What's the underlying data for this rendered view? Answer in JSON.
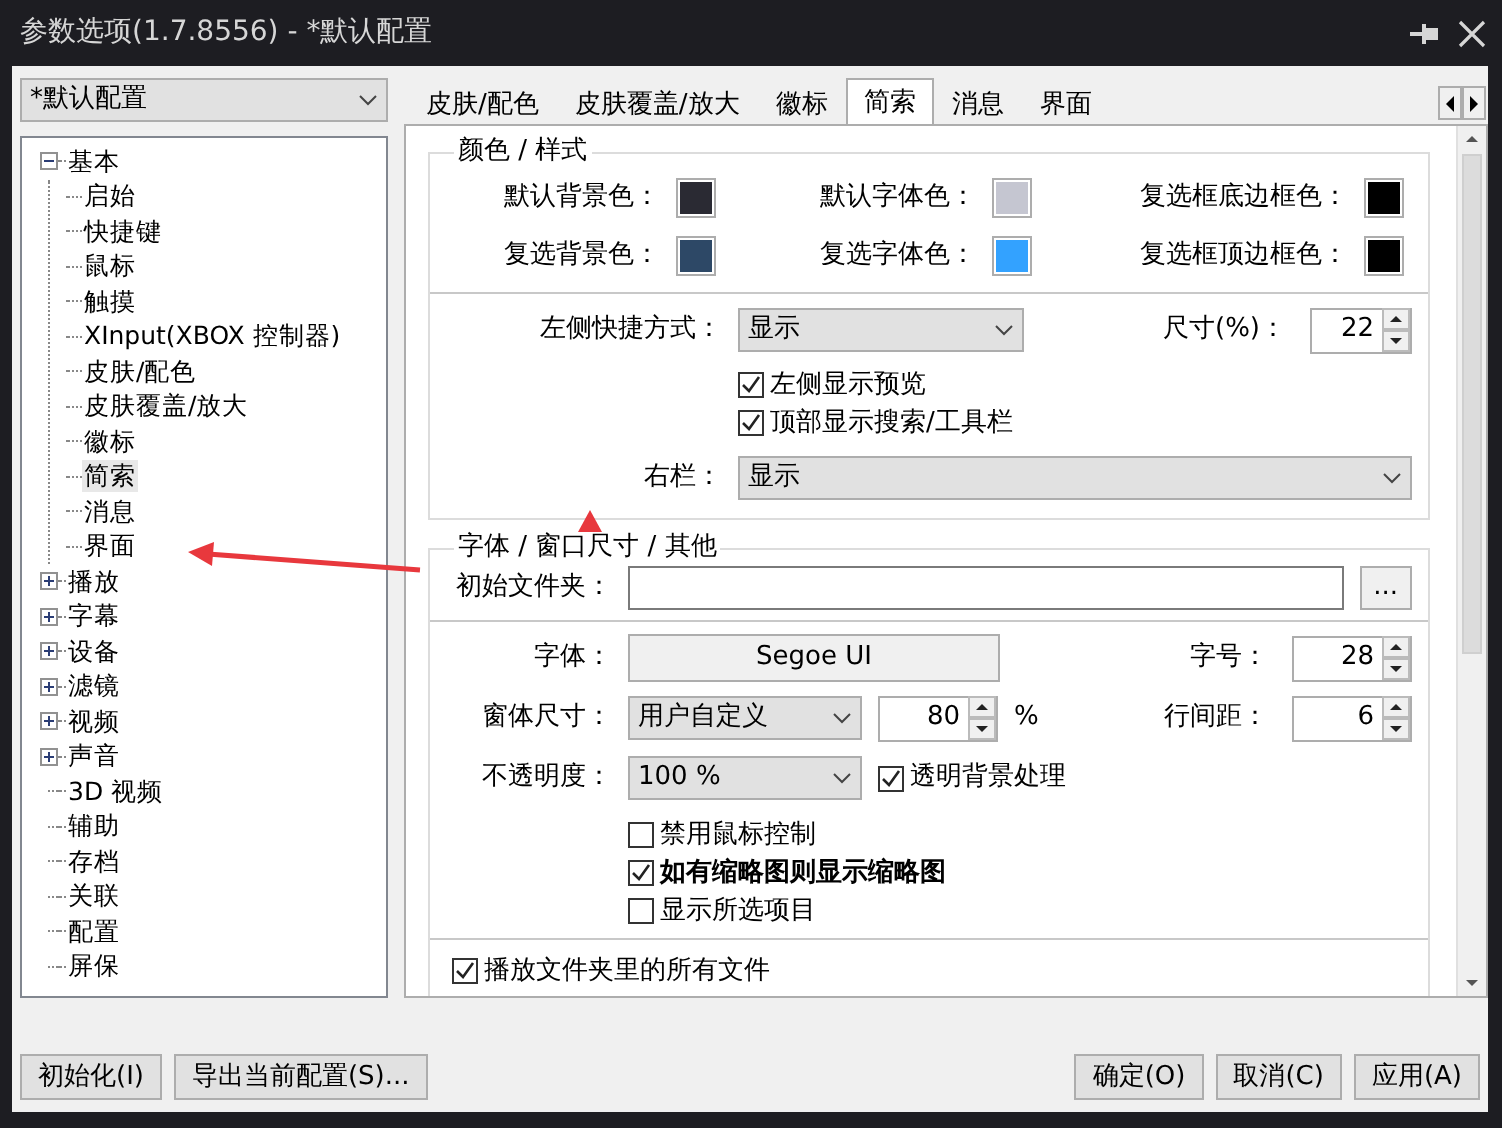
{
  "window": {
    "title": "参数选项(1.7.8556) - *默认配置"
  },
  "profile_select": {
    "value": "*默认配置"
  },
  "tree": [
    {
      "label": "基本",
      "kind": "group",
      "expanded": true,
      "selected": false,
      "children": [
        {
          "label": "启始",
          "selected": false
        },
        {
          "label": "快捷键",
          "selected": false
        },
        {
          "label": "鼠标",
          "selected": false
        },
        {
          "label": "触摸",
          "selected": false
        },
        {
          "label": "XInput(XBOX 控制器)",
          "selected": false
        },
        {
          "label": "皮肤/配色",
          "selected": false
        },
        {
          "label": "皮肤覆盖/放大",
          "selected": false
        },
        {
          "label": "徽标",
          "selected": false
        },
        {
          "label": "简索",
          "selected": true
        },
        {
          "label": "消息",
          "selected": false
        },
        {
          "label": "界面",
          "selected": false
        }
      ]
    },
    {
      "label": "播放",
      "kind": "group",
      "expanded": false,
      "selected": false
    },
    {
      "label": "字幕",
      "kind": "group",
      "expanded": false,
      "selected": false
    },
    {
      "label": "设备",
      "kind": "group",
      "expanded": false,
      "selected": false
    },
    {
      "label": "滤镜",
      "kind": "group",
      "expanded": false,
      "selected": false
    },
    {
      "label": "视频",
      "kind": "group",
      "expanded": false,
      "selected": false
    },
    {
      "label": "声音",
      "kind": "group",
      "expanded": false,
      "selected": false
    },
    {
      "label": "3D 视频",
      "kind": "leaf",
      "selected": false
    },
    {
      "label": "辅助",
      "kind": "leaf",
      "selected": false
    },
    {
      "label": "存档",
      "kind": "leaf",
      "selected": false
    },
    {
      "label": "关联",
      "kind": "leaf",
      "selected": false
    },
    {
      "label": "配置",
      "kind": "leaf",
      "selected": false
    },
    {
      "label": "屏保",
      "kind": "leaf",
      "selected": false
    }
  ],
  "tabs": [
    {
      "label": "皮肤/配色",
      "selected": false
    },
    {
      "label": "皮肤覆盖/放大",
      "selected": false
    },
    {
      "label": "徽标",
      "selected": false
    },
    {
      "label": "简索",
      "selected": true
    },
    {
      "label": "消息",
      "selected": false
    },
    {
      "label": "界面",
      "selected": false
    }
  ],
  "color_style": {
    "title": "颜色 / 样式",
    "colors": [
      {
        "label": "默认背景色：",
        "color": "#2a2a33"
      },
      {
        "label": "默认字体色：",
        "color": "#c5c6d1"
      },
      {
        "label": "复选框底边框色：",
        "color": "#000000"
      },
      {
        "label": "复选背景色：",
        "color": "#2d4866"
      },
      {
        "label": "复选字体色：",
        "color": "#33a2ff"
      },
      {
        "label": "复选框顶边框色：",
        "color": "#000000"
      }
    ],
    "left_shortcut": {
      "label": "左侧快捷方式：",
      "value": "显示"
    },
    "size": {
      "label": "尺寸(%)：",
      "value": "22"
    },
    "checkboxes": [
      {
        "label": "左侧显示预览",
        "checked": true
      },
      {
        "label": "顶部显示搜索/工具栏",
        "checked": true
      }
    ],
    "right_bar": {
      "label": "右栏：",
      "value": "显示"
    }
  },
  "font_window": {
    "title": "字体 / 窗口尺寸 / 其他",
    "start_folder": {
      "label": "初始文件夹：",
      "button": "..."
    },
    "font": {
      "label": "字体：",
      "value": "Segoe UI"
    },
    "font_size": {
      "label": "字号：",
      "value": "28"
    },
    "window_size": {
      "label": "窗体尺寸：",
      "value": "用户自定义",
      "percent": "80",
      "unit": "%"
    },
    "line_spacing": {
      "label": "行间距：",
      "value": "6"
    },
    "opacity": {
      "label": "不透明度：",
      "value": "100 %"
    },
    "transparent_bg": {
      "label": "透明背景处理",
      "checked": true
    },
    "checkboxes": [
      {
        "label": "禁用鼠标控制",
        "checked": false,
        "bold": false
      },
      {
        "label": "如有缩略图则显示缩略图",
        "checked": true,
        "bold": true
      },
      {
        "label": "显示所选项目",
        "checked": false,
        "bold": false
      }
    ],
    "play_all": {
      "label": "播放文件夹里的所有文件",
      "checked": true
    }
  },
  "footer": {
    "left_buttons": [
      "初始化(I)",
      "导出当前配置(S)..."
    ],
    "right_buttons": [
      "确定(O)",
      "取消(C)",
      "应用(A)"
    ]
  }
}
